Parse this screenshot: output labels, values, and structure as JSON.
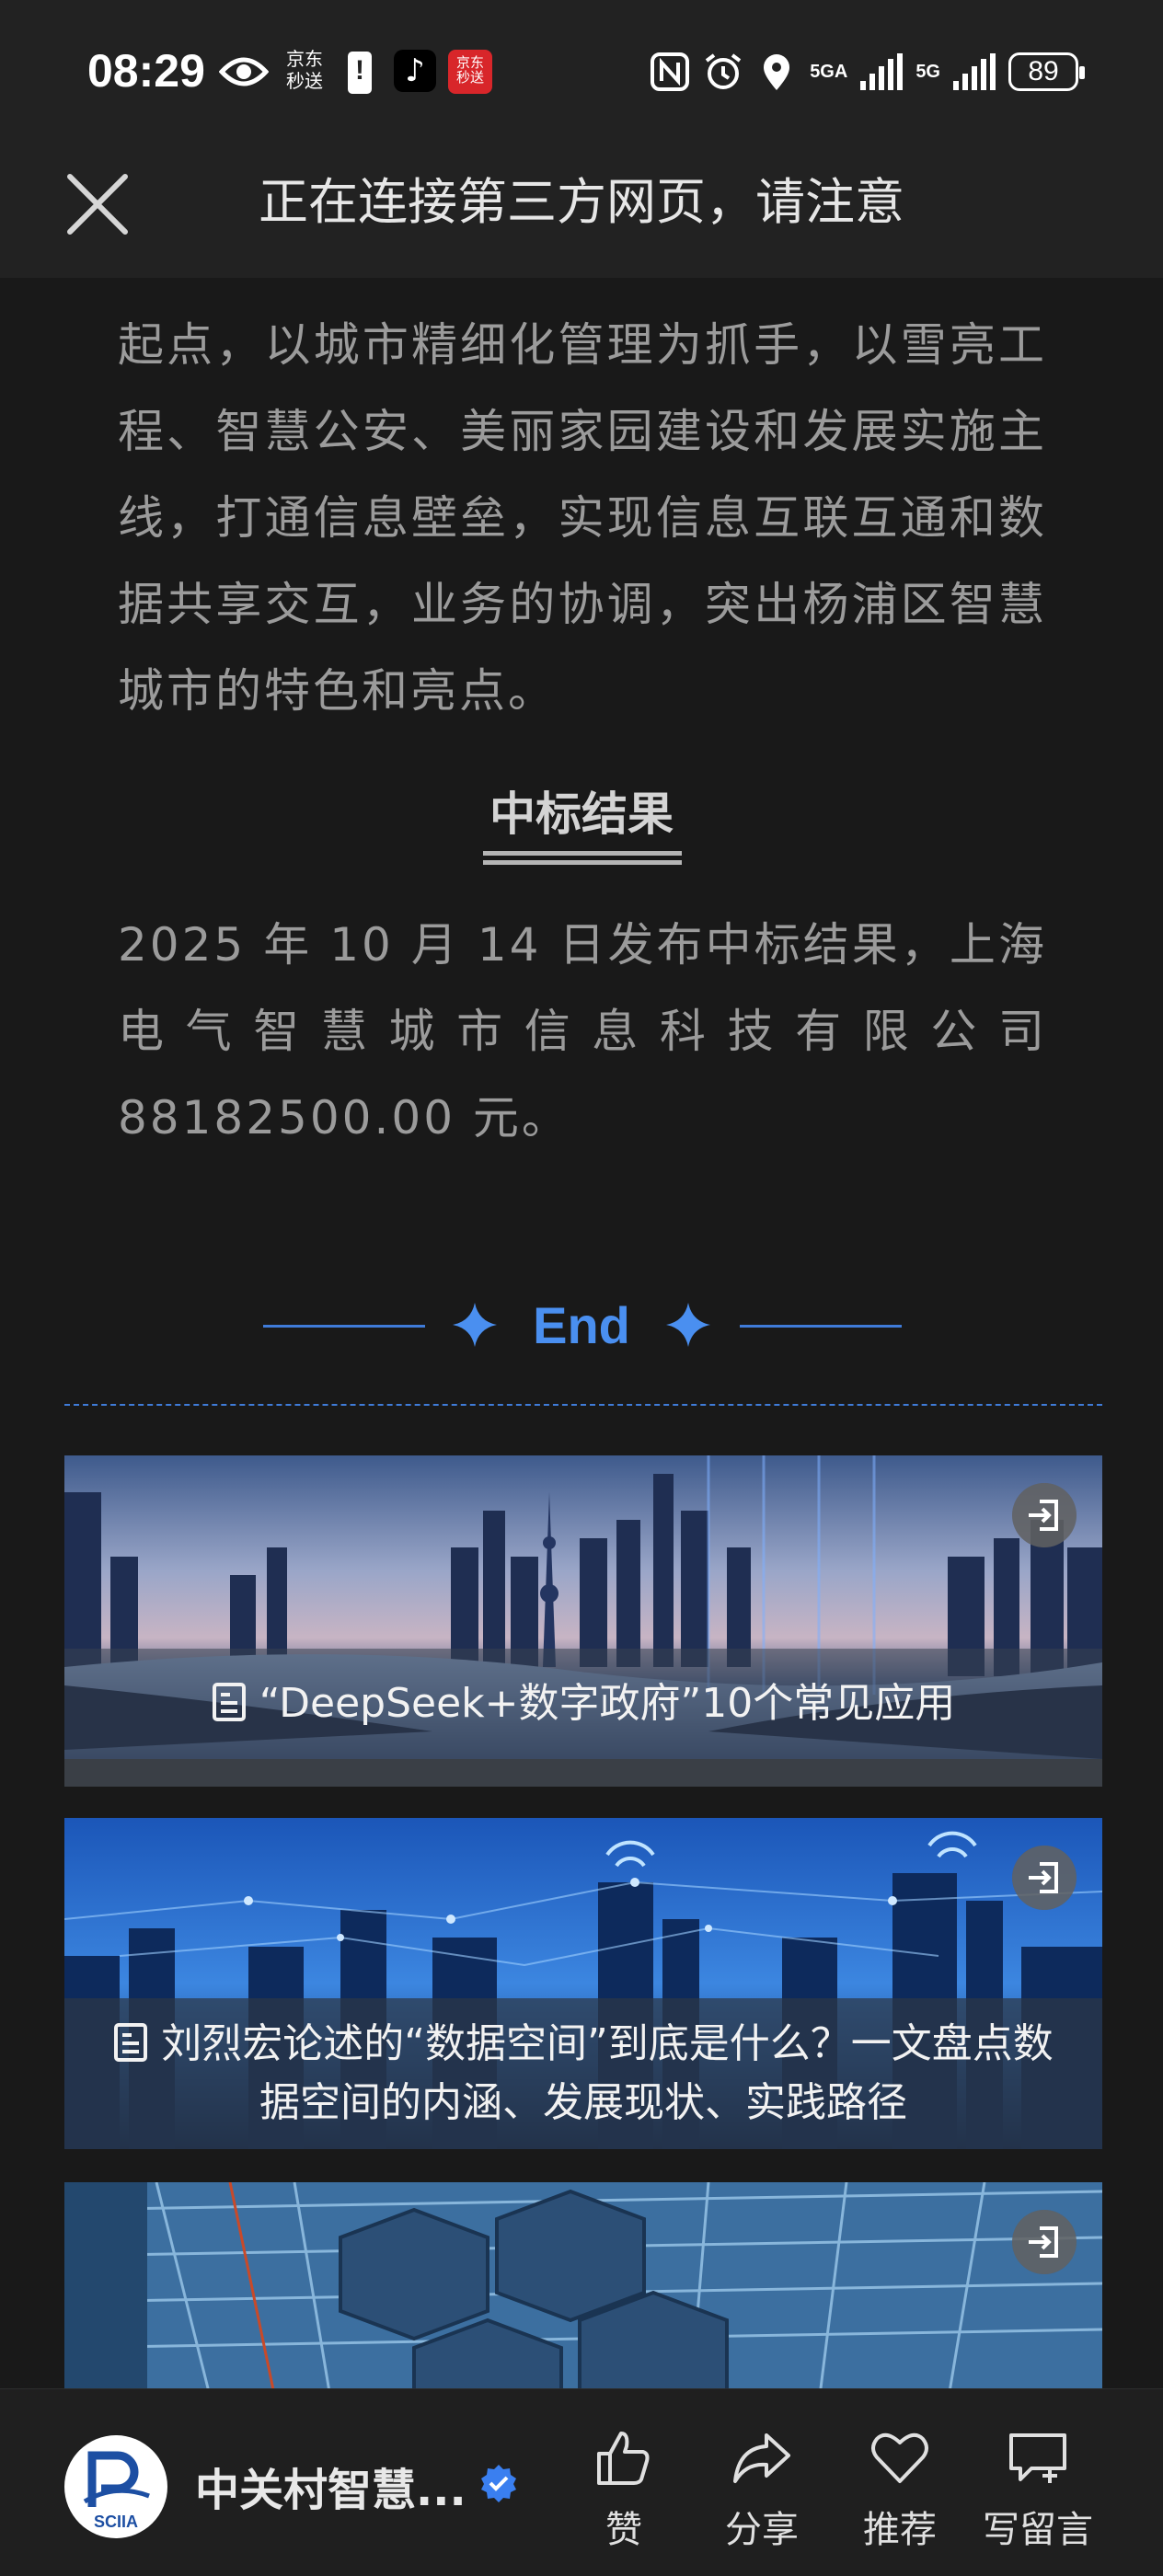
{
  "status_bar": {
    "time": "08:29",
    "jd_label": "京东\n秒送",
    "jd_app_label": "京东\n秒送",
    "network1": "5GA",
    "network2": "5G",
    "battery": "89",
    "icons": [
      "eye-icon",
      "alert-icon",
      "tiktok-icon",
      "jd-icon",
      "nfc-icon",
      "alarm-icon",
      "location-icon",
      "signal-icon",
      "battery-icon"
    ]
  },
  "notice": {
    "title": "正在连接第三方网页，请注意"
  },
  "article": {
    "paragraph1": "起点，以城市精细化管理为抓手，以雪亮工程、智慧公安、美丽家园建设和发展实施主线，打通信息壁垒，实现信息互联互通和数据共享交互，业务的协调，突出杨浦区智慧城市的特色和亮点。",
    "section_title": "中标结果",
    "paragraph2": "2025 年 10 月 14 日发布中标结果，上海电气智慧城市信息科技有限公司 88182500.00 元。",
    "end_label": "End"
  },
  "cards": [
    {
      "caption": "“DeepSeek+数字政府”10个常见应用"
    },
    {
      "caption": "刘烈宏论述的“数据空间”到底是什么？一文盘点数据空间的内涵、发展现状、实践路径"
    },
    {
      "caption": ""
    }
  ],
  "bottom_bar": {
    "account_name": "中关村智慧...",
    "avatar_text": "SCIIA",
    "actions": {
      "like": "赞",
      "share": "分享",
      "recommend": "推荐",
      "comment": "写留言"
    }
  },
  "colors": {
    "background": "#191919",
    "accent": "#4a8ff0",
    "bar": "#222222"
  }
}
